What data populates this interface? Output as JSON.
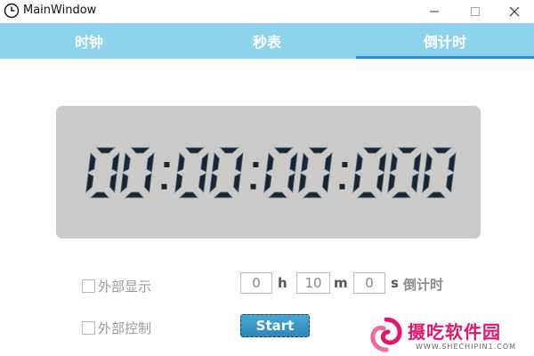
{
  "window": {
    "title": "MainWindow",
    "icon": "clock-icon"
  },
  "tabs": [
    {
      "label": "时钟",
      "active": false
    },
    {
      "label": "秒表",
      "active": false
    },
    {
      "label": "倒计时",
      "active": true
    }
  ],
  "display": {
    "time_text": "00:00:00:000",
    "background": "#cbcac8",
    "digit_color": "#1b2430"
  },
  "options": {
    "external_display_label": "外部显示",
    "external_display_checked": false,
    "external_control_label": "外部控制",
    "external_control_checked": false
  },
  "timer_input": {
    "hours_value": "0",
    "hours_unit": "h",
    "minutes_value": "10",
    "minutes_unit": "m",
    "seconds_value": "0",
    "seconds_unit": "s",
    "mode_label": "倒计时"
  },
  "start_button": {
    "label": "Start"
  },
  "watermark": {
    "title": "摄吃软件园",
    "url": "WWW.SHECHIPIN1.COM"
  },
  "colors": {
    "tab_bar": "#8ed3ec",
    "active_underline": "#2a8fd6",
    "start_button": "#3b9dcb",
    "watermark": "#e2166c"
  }
}
